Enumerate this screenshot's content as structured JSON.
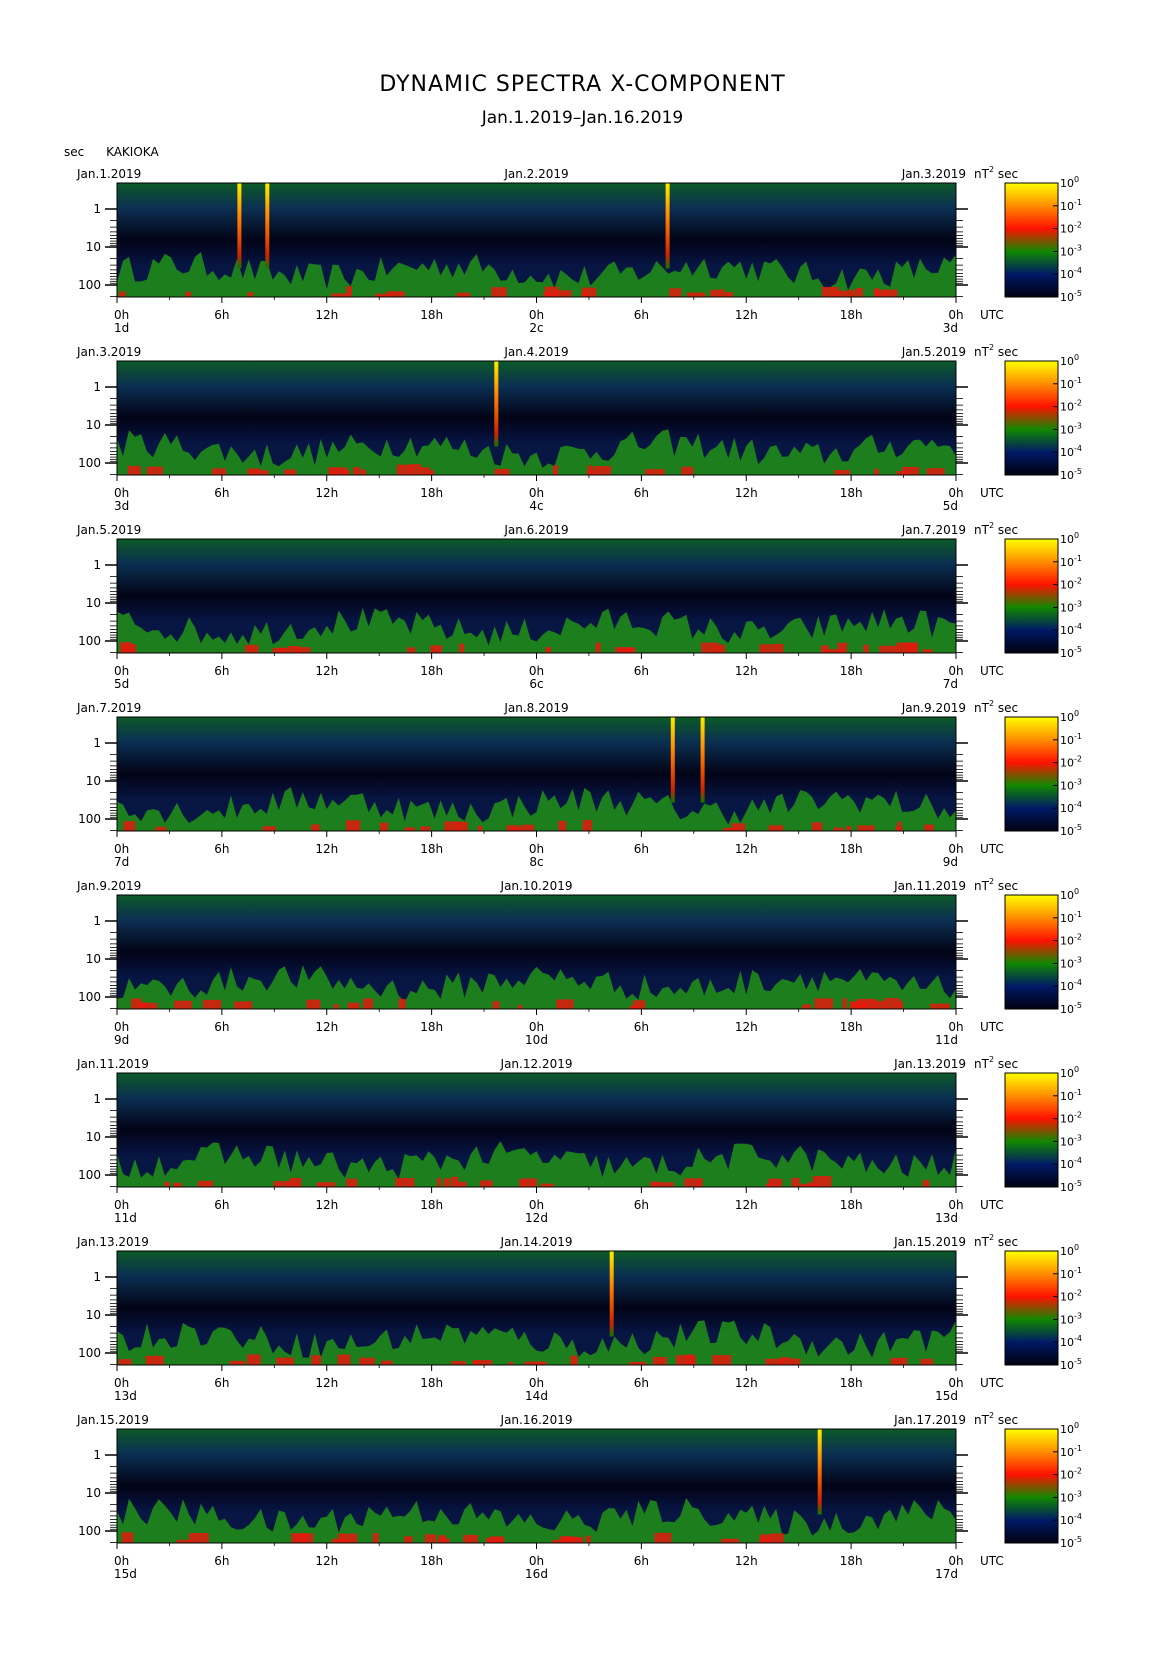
{
  "header": {
    "title": "DYNAMIC SPECTRA X-COMPONENT",
    "subtitle": "Jan.1.2019–Jan.16.2019",
    "unit": "sec",
    "station": "KAKIOKA"
  },
  "chart_data": {
    "type": "heatmap",
    "y_axis": {
      "label": "sec",
      "ticks": [
        "1",
        "10",
        "100"
      ],
      "scale": "log"
    },
    "x_axis": {
      "ticks": [
        "0h",
        "6h",
        "12h",
        "18h",
        "0h",
        "6h",
        "12h",
        "18h",
        "0h"
      ],
      "end_label": "UTC"
    },
    "colorbar": {
      "unit_prefix": "nT",
      "unit_exp": "2",
      "unit_suffix": "sec",
      "ticks": [
        {
          "base": "10",
          "exp": "0"
        },
        {
          "base": "10",
          "exp": "-1"
        },
        {
          "base": "10",
          "exp": "-2"
        },
        {
          "base": "10",
          "exp": "-3"
        },
        {
          "base": "10",
          "exp": "-4"
        },
        {
          "base": "10",
          "exp": "-5"
        }
      ],
      "colors": [
        "#ffff00",
        "#ff8800",
        "#ff0000",
        "#008800",
        "#001a66",
        "#000000"
      ]
    },
    "panels": [
      {
        "left_date": "Jan.1.2019",
        "mid_date": "Jan.2.2019",
        "right_date": "Jan.3.2019",
        "day_labels": [
          "1d",
          "2c",
          "3d"
        ],
        "spikes": [
          7.0,
          8.6,
          31.5
        ]
      },
      {
        "left_date": "Jan.3.2019",
        "mid_date": "Jan.4.2019",
        "right_date": "Jan.5.2019",
        "day_labels": [
          "3d",
          "4c",
          "5d"
        ],
        "spikes": [
          21.7
        ]
      },
      {
        "left_date": "Jan.5.2019",
        "mid_date": "Jan.6.2019",
        "right_date": "Jan.7.2019",
        "day_labels": [
          "5d",
          "6c",
          "7d"
        ],
        "spikes": []
      },
      {
        "left_date": "Jan.7.2019",
        "mid_date": "Jan.8.2019",
        "right_date": "Jan.9.2019",
        "day_labels": [
          "7d",
          "8c",
          "9d"
        ],
        "spikes": [
          31.8,
          33.5
        ]
      },
      {
        "left_date": "Jan.9.2019",
        "mid_date": "Jan.10.2019",
        "right_date": "Jan.11.2019",
        "day_labels": [
          "9d",
          "10d",
          "11d"
        ],
        "spikes": []
      },
      {
        "left_date": "Jan.11.2019",
        "mid_date": "Jan.12.2019",
        "right_date": "Jan.13.2019",
        "day_labels": [
          "11d",
          "12d",
          "13d"
        ],
        "spikes": []
      },
      {
        "left_date": "Jan.13.2019",
        "mid_date": "Jan.14.2019",
        "right_date": "Jan.15.2019",
        "day_labels": [
          "13d",
          "14d",
          "15d"
        ],
        "spikes": [
          28.3
        ]
      },
      {
        "left_date": "Jan.15.2019",
        "mid_date": "Jan.16.2019",
        "right_date": "Jan.17.2019",
        "day_labels": [
          "15d",
          "16d",
          "17d"
        ],
        "spikes": [
          40.2
        ]
      }
    ]
  }
}
